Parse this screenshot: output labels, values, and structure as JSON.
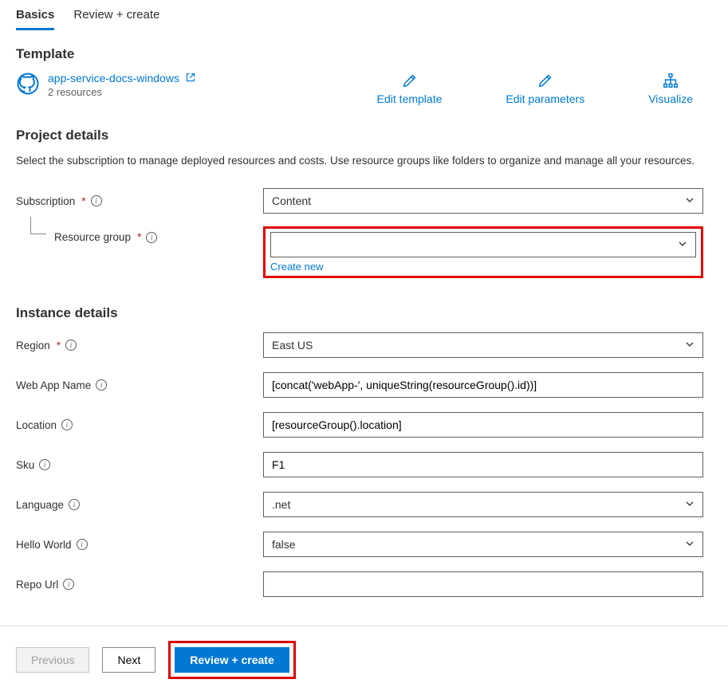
{
  "tabs": {
    "basics": "Basics",
    "review": "Review + create"
  },
  "template": {
    "heading": "Template",
    "link_text": "app-service-docs-windows",
    "sub": "2 resources",
    "actions": {
      "edit_template": "Edit template",
      "edit_parameters": "Edit parameters",
      "visualize": "Visualize"
    }
  },
  "project": {
    "heading": "Project details",
    "desc": "Select the subscription to manage deployed resources and costs. Use resource groups like folders to organize and manage all your resources.",
    "subscription_label": "Subscription",
    "subscription_value": "Content",
    "rg_label": "Resource group",
    "rg_value": "",
    "rg_create_new": "Create new"
  },
  "instance": {
    "heading": "Instance details",
    "region_label": "Region",
    "region_value": "East US",
    "webapp_label": "Web App Name",
    "webapp_value": "[concat('webApp-', uniqueString(resourceGroup().id))]",
    "location_label": "Location",
    "location_value": "[resourceGroup().location]",
    "sku_label": "Sku",
    "sku_value": "F1",
    "language_label": "Language",
    "language_value": ".net",
    "hello_label": "Hello World",
    "hello_value": "false",
    "repo_label": "Repo Url",
    "repo_value": ""
  },
  "footer": {
    "previous": "Previous",
    "next": "Next",
    "review": "Review + create"
  }
}
